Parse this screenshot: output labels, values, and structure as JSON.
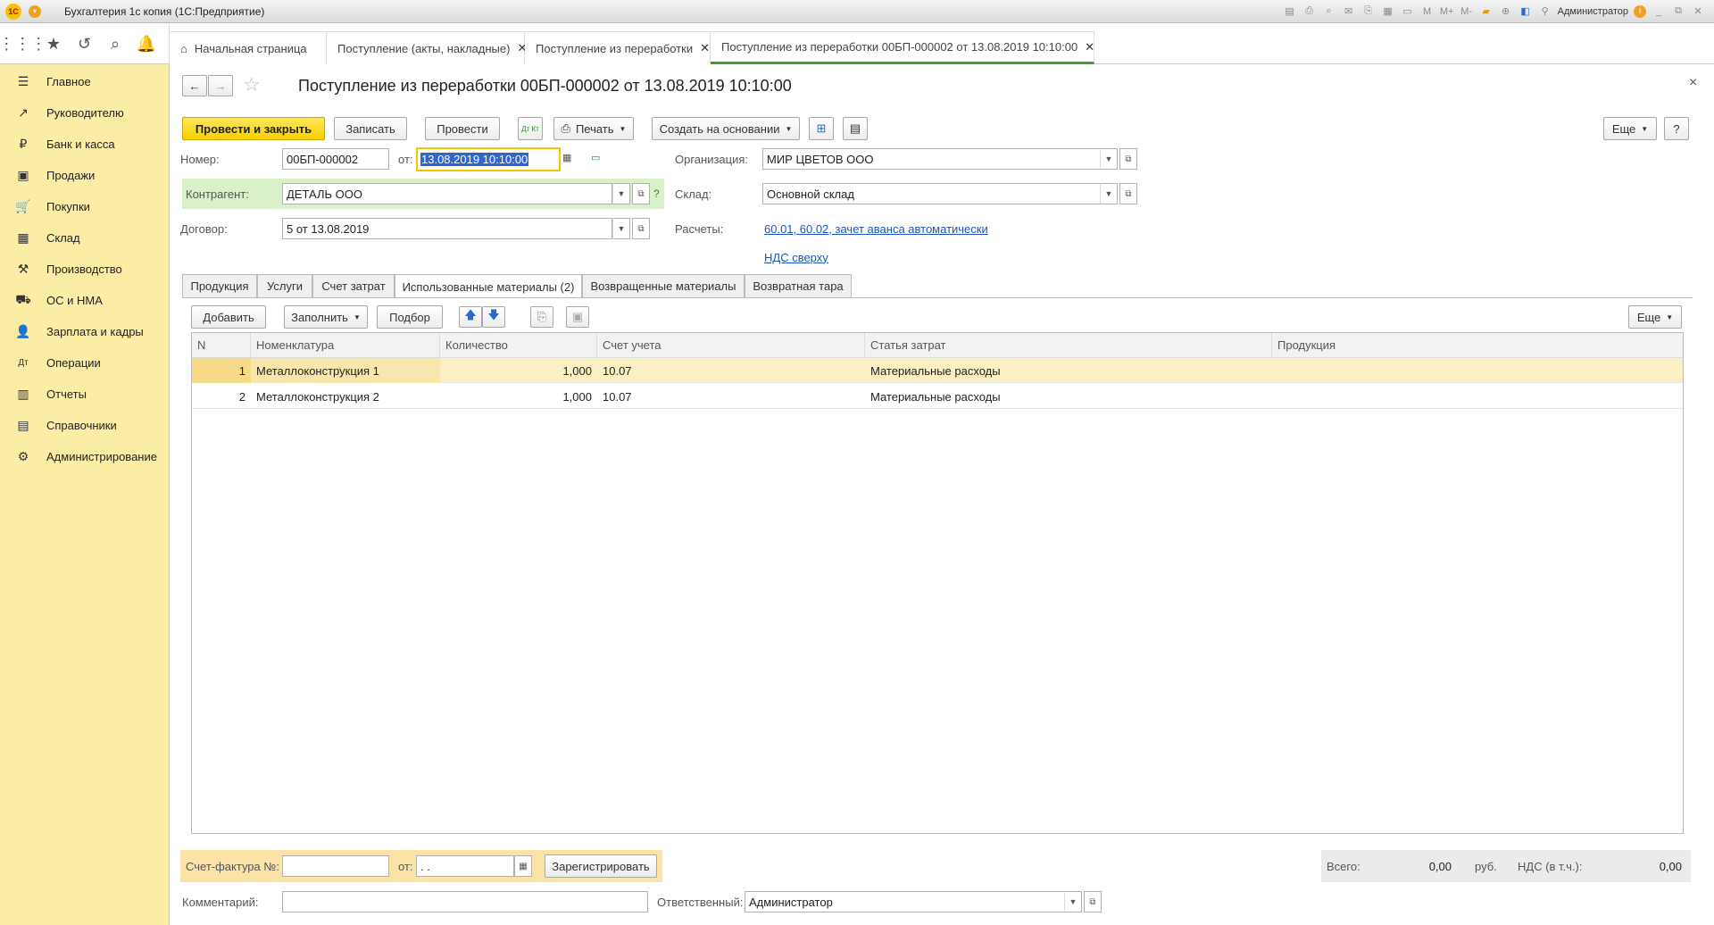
{
  "titlebar": {
    "logo": "1С",
    "app_title": "Бухгалтерия 1с копия  (1С:Предприятие)",
    "user": "Администратор",
    "icons": [
      "save-icon",
      "print-icon",
      "preview-icon",
      "mail-icon",
      "copy-doc-icon",
      "calc-icon",
      "calendar-icon",
      "memory-m-icon",
      "memory-plus-icon",
      "memory-minus-icon",
      "folder-icon",
      "zoom-icon",
      "panel-icon",
      "tools-icon"
    ],
    "mem_labels": [
      "M",
      "M+",
      "M-"
    ],
    "info": "i",
    "window_buttons": [
      "_",
      "⧉",
      "✕"
    ]
  },
  "nav": {
    "icons": [
      "apps-grid-icon",
      "star-icon",
      "history-icon",
      "search-icon",
      "bell-icon"
    ],
    "tabs": [
      {
        "label": "Начальная страница",
        "home": true
      },
      {
        "label": "Поступление (акты, накладные)",
        "close": "✕"
      },
      {
        "label": "Поступление из переработки",
        "close": "✕"
      },
      {
        "label": "Поступление из переработки 00БП-000002 от 13.08.2019 10:10:00",
        "close": "✕",
        "active": true
      }
    ]
  },
  "sidebar": {
    "items": [
      {
        "label": "Главное",
        "icon": "menu-lines-icon",
        "glyph": "☰"
      },
      {
        "label": "Руководителю",
        "icon": "chart-line-icon",
        "glyph": "↗"
      },
      {
        "label": "Банк и касса",
        "icon": "coin-icon",
        "glyph": "₽"
      },
      {
        "label": "Продажи",
        "icon": "bag-icon",
        "glyph": "▣"
      },
      {
        "label": "Покупки",
        "icon": "cart-icon",
        "glyph": "🛒"
      },
      {
        "label": "Склад",
        "icon": "warehouse-icon",
        "glyph": "▦"
      },
      {
        "label": "Производство",
        "icon": "factory-icon",
        "glyph": "⚒"
      },
      {
        "label": "ОС и НМА",
        "icon": "truck-icon",
        "glyph": "⛟"
      },
      {
        "label": "Зарплата и кадры",
        "icon": "person-icon",
        "glyph": "👤"
      },
      {
        "label": "Операции",
        "icon": "dt-kt-icon",
        "glyph": "Дт"
      },
      {
        "label": "Отчеты",
        "icon": "report-icon",
        "glyph": "▥"
      },
      {
        "label": "Справочники",
        "icon": "book-icon",
        "glyph": "▤"
      },
      {
        "label": "Администрирование",
        "icon": "gear-icon",
        "glyph": "⚙"
      }
    ]
  },
  "doc": {
    "title": "Поступление из переработки 00БП-000002 от 13.08.2019 10:10:00",
    "close": "×",
    "back": "←",
    "forward": "→",
    "star": "☆"
  },
  "toolbar": {
    "post_close": "Провести и закрыть",
    "write": "Записать",
    "post": "Провести",
    "dtkt": "Дт Кт",
    "print": "Печать",
    "create_based": "Создать на основании",
    "more": "Еще",
    "help": "?"
  },
  "form": {
    "number_label": "Номер:",
    "number": "00БП-000002",
    "from_label": "от:",
    "date": "13.08.2019 10:10:00",
    "contractor_label": "Контрагент:",
    "contractor": "ДЕТАЛЬ ООО",
    "q": "?",
    "contract_label": "Договор:",
    "contract": "5 от 13.08.2019",
    "org_label": "Организация:",
    "org": "МИР ЦВЕТОВ ООО",
    "warehouse_label": "Склад:",
    "warehouse": "Основной склад",
    "settlements_label": "Расчеты:",
    "settlements_link": "60.01, 60.02, зачет аванса автоматически",
    "vat_link": "НДС сверху"
  },
  "form_tabs": [
    "Продукция",
    "Услуги",
    "Счет затрат",
    "Использованные материалы (2)",
    "Возвращенные материалы",
    "Возвратная тара"
  ],
  "table_toolbar": {
    "add": "Добавить",
    "fill": "Заполнить",
    "pick": "Подбор",
    "up": "🡅",
    "down": "🡇",
    "more": "Еще"
  },
  "table": {
    "columns": [
      "N",
      "Номенклатура",
      "Количество",
      "Счет учета",
      "Статья затрат",
      "Продукция"
    ],
    "rows": [
      {
        "n": "1",
        "item": "Металлоконструкция 1",
        "qty": "1,000",
        "account": "10.07",
        "cost": "Материальные расходы",
        "product": ""
      },
      {
        "n": "2",
        "item": "Металлоконструкция 2",
        "qty": "1,000",
        "account": "10.07",
        "cost": "Материальные расходы",
        "product": ""
      }
    ]
  },
  "footer": {
    "invoice_label": "Счет-фактура №:",
    "invoice_number": "",
    "from_label": "от:",
    "invoice_date": " .  . ",
    "register": "Зарегистрировать",
    "total_label": "Всего:",
    "total": "0,00",
    "currency": "руб.",
    "vat_label": "НДС (в т.ч.):",
    "vat": "0,00",
    "comment_label": "Комментарий:",
    "comment": "",
    "responsible_label": "Ответственный:",
    "responsible": "Администратор"
  }
}
